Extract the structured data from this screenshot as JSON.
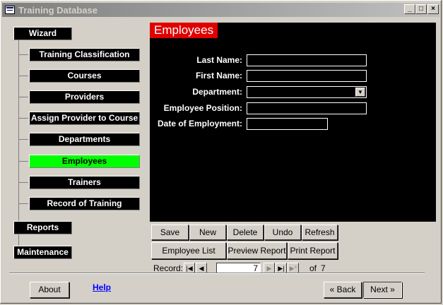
{
  "window": {
    "title": "Training Database",
    "minimize": "_",
    "maximize": "□",
    "close": "×"
  },
  "wizard": {
    "label": "Wizard",
    "items": [
      {
        "label": "Training Classification",
        "active": false
      },
      {
        "label": "Courses",
        "active": false
      },
      {
        "label": "Providers",
        "active": false
      },
      {
        "label": "Assign Provider to Course",
        "active": false
      },
      {
        "label": "Departments",
        "active": false
      },
      {
        "label": "Employees",
        "active": true
      },
      {
        "label": "Trainers",
        "active": false
      },
      {
        "label": "Record of Training",
        "active": false
      }
    ],
    "reports_label": "Reports",
    "maintenance_label": "Maintenance"
  },
  "form": {
    "heading": "Employees",
    "fields": {
      "last_name": {
        "label": "Last Name:",
        "value": ""
      },
      "first_name": {
        "label": "First Name:",
        "value": ""
      },
      "department": {
        "label": "Department:",
        "value": ""
      },
      "position": {
        "label": "Employee Position:",
        "value": ""
      },
      "date_employed": {
        "label": "Date of Employment:",
        "value": ""
      }
    }
  },
  "actions": {
    "save": "Save",
    "new": "New",
    "delete": "Delete",
    "undo": "Undo",
    "refresh": "Refresh",
    "employee_list": "Employee List",
    "preview_report": "Preview Report",
    "print_report": "Print Report"
  },
  "record_nav": {
    "label": "Record:",
    "current": "7",
    "of_label": "of",
    "total": "7"
  },
  "footer": {
    "about": "About",
    "help": "Help",
    "back": "« Back",
    "next": "Next »"
  },
  "colors": {
    "active_item": "#00ff00",
    "heading_bg": "#e00000",
    "panel_bg": "#000000"
  }
}
